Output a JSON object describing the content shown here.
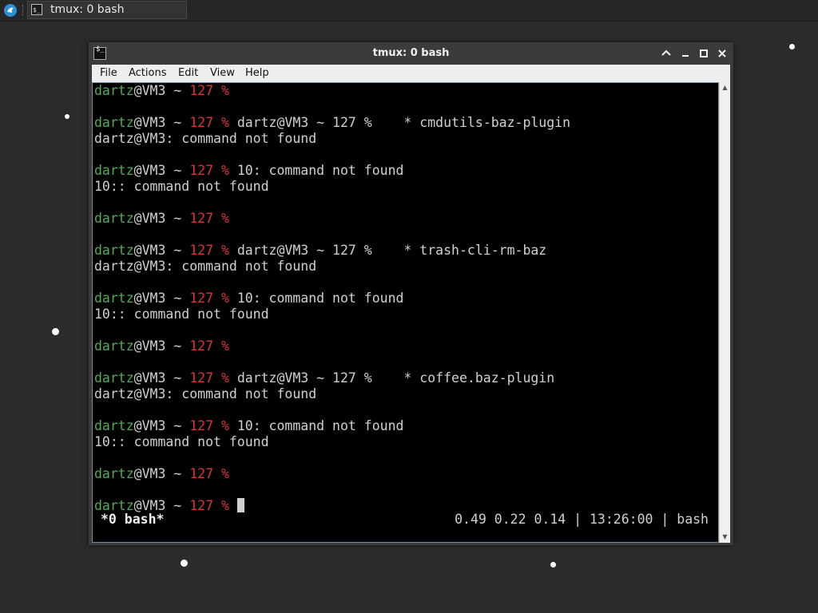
{
  "taskbar": {
    "task_label": "tmux: 0 bash"
  },
  "window": {
    "title": "tmux: 0 bash",
    "menu": [
      "File",
      "Actions",
      "Edit",
      "View",
      "Help"
    ]
  },
  "terminal": {
    "prompt_user": "dartz",
    "prompt_host": "@VM3 ~ ",
    "prompt_code": "127 %",
    "lines": [
      {
        "prompt": true,
        "cmd": ""
      },
      {
        "prompt": false,
        "text": ""
      },
      {
        "prompt": true,
        "cmd": " dartz@VM3 ~ 127 %    * cmdutils-baz-plugin"
      },
      {
        "prompt": false,
        "text": "dartz@VM3: command not found"
      },
      {
        "prompt": false,
        "text": ""
      },
      {
        "prompt": true,
        "cmd": " 10: command not found"
      },
      {
        "prompt": false,
        "text": "10:: command not found"
      },
      {
        "prompt": false,
        "text": ""
      },
      {
        "prompt": true,
        "cmd": ""
      },
      {
        "prompt": false,
        "text": ""
      },
      {
        "prompt": true,
        "cmd": " dartz@VM3 ~ 127 %    * trash-cli-rm-baz"
      },
      {
        "prompt": false,
        "text": "dartz@VM3: command not found"
      },
      {
        "prompt": false,
        "text": ""
      },
      {
        "prompt": true,
        "cmd": " 10: command not found"
      },
      {
        "prompt": false,
        "text": "10:: command not found"
      },
      {
        "prompt": false,
        "text": ""
      },
      {
        "prompt": true,
        "cmd": ""
      },
      {
        "prompt": false,
        "text": ""
      },
      {
        "prompt": true,
        "cmd": " dartz@VM3 ~ 127 %    * coffee.baz-plugin"
      },
      {
        "prompt": false,
        "text": "dartz@VM3: command not found"
      },
      {
        "prompt": false,
        "text": ""
      },
      {
        "prompt": true,
        "cmd": " 10: command not found"
      },
      {
        "prompt": false,
        "text": "10:: command not found"
      },
      {
        "prompt": false,
        "text": ""
      },
      {
        "prompt": true,
        "cmd": ""
      },
      {
        "prompt": false,
        "text": ""
      },
      {
        "prompt": true,
        "cmd": " ",
        "cursor": true
      }
    ],
    "status_left": "*0 bash*",
    "status_right": "0.49 0.22 0.14 | 13:26:00 | bash"
  },
  "colors": {
    "prompt_user": "#4caf50",
    "prompt_code": "#d6343e",
    "terminal_bg": "#000000"
  },
  "icons": {
    "start": "start-menu-icon",
    "terminal": "terminal-icon",
    "minimize": "minimize-icon",
    "restore": "restore-icon",
    "maximize": "maximize-icon",
    "close": "close-icon"
  }
}
